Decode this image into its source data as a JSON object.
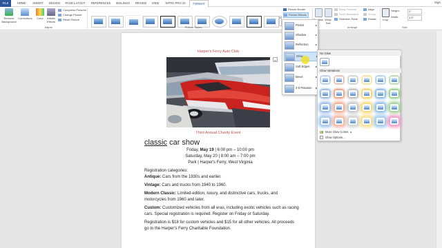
{
  "tabs": [
    "FILE",
    "HOME",
    "INSERT",
    "DESIGN",
    "PAGE LAYOUT",
    "REFERENCES",
    "MAILINGS",
    "REVIEW",
    "VIEW",
    "NITRO PRO 10",
    "FORMAT"
  ],
  "sign_in": "Sign",
  "ribbon": {
    "remove_background": "Remove Background",
    "corrections": "Corrections",
    "color": "Color",
    "artistic_effects": "Artistic Effects",
    "compress": "Compress Pictures",
    "change": "Change Picture",
    "reset": "Reset Picture",
    "adjust_label": "Adjust",
    "styles_label": "Picture Styles",
    "border": "Picture Border",
    "effects": "Picture Effects",
    "position": "Position",
    "wrap_text": "Wrap Text",
    "bring_forward": "Bring Forward",
    "send_backward": "Send Backward",
    "selection_pane": "Selection Pane",
    "align": "Align",
    "group": "Group",
    "rotate": "Rotate",
    "arrange_label": "Arrange",
    "crop": "Crop",
    "height_label": "Height:",
    "height_value": "2\"",
    "width_label": "Width:",
    "width_value": "4.5\"",
    "size_label": "Size"
  },
  "effects_menu": {
    "items": [
      "Preset",
      "Shadow",
      "Reflection",
      "Glow",
      "Soft Edges",
      "Bevel",
      "3-D Rotation"
    ]
  },
  "glow_menu": {
    "no_glow": "No Glow",
    "variations": "Glow Variations",
    "more_colors": "More Glow Colors",
    "options": "Glow Options..."
  },
  "doc": {
    "header": "Harper's Ferry Auto Club",
    "caption": "Third Annual Charity Event",
    "title_a": "classic",
    "title_b": " car show",
    "date1_a": "Friday, ",
    "date1_b": "May 19",
    "date1_c": " | 6:00 pm – 10:00 pm",
    "date2": "Saturday, May 20 | 8:00 am – 7:00 pm",
    "location": "Park | Harper's Ferry, West Virginia",
    "reg_cats": "Registration categories:",
    "antique_b": "Antique:",
    "antique": " Cars from the 1930s and earlier.",
    "vintage_b": "Vintage:",
    "vintage": " Cars and trucks from 1940 to 1960.",
    "modern_b": "Modern Classic:",
    "modern1": " Limited-edition, luxury, and distinctive cars, trucks, and",
    "modern2": "motorcycles from 1960 and later.",
    "custom_b": "Custom:",
    "custom1": " Customized vehicles from all eras, including exotic vehicles such as racing",
    "custom2": "cars. Special registration is required. Register on Friday or Saturday.",
    "fee1": "Registration is $18 for custom vehicles and $15 for all other vehicles. All proceeds",
    "fee2": "go to the Harper's Ferry Charitable Foundation."
  },
  "colors": {
    "accent": "#2b579a",
    "doc_red": "#c0504d"
  }
}
